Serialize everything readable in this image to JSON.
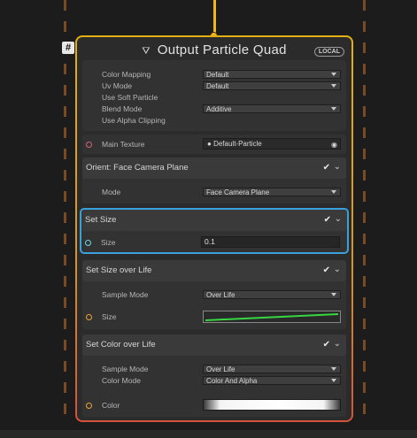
{
  "header": {
    "title": "Output Particle Quad",
    "badge": "LOCAL",
    "hash_label": "#"
  },
  "output_settings": {
    "rows": [
      {
        "label": "Color Mapping",
        "value": "Default"
      },
      {
        "label": "Uv Mode",
        "value": "Default"
      },
      {
        "label": "Use Soft Particle",
        "value": ""
      },
      {
        "label": "Blend Mode",
        "value": "Additive"
      },
      {
        "label": "Use Alpha Clipping",
        "value": ""
      }
    ],
    "main_texture": {
      "label": "Main Texture",
      "value": "Default-Particle"
    }
  },
  "blocks": {
    "orient": {
      "title": "Orient: Face Camera Plane",
      "mode_label": "Mode",
      "mode_value": "Face Camera Plane"
    },
    "set_size": {
      "title": "Set Size",
      "size_label": "Size",
      "size_value": "0.1"
    },
    "size_over_life": {
      "title": "Set Size over Life",
      "sample_label": "Sample Mode",
      "sample_value": "Over Life",
      "size_label": "Size"
    },
    "color_over_life": {
      "title": "Set Color over Life",
      "sample_label": "Sample Mode",
      "sample_value": "Over Life",
      "color_mode_label": "Color Mode",
      "color_mode_value": "Color And Alpha",
      "color_label": "Color"
    }
  },
  "icons": {
    "checkbox": "✔",
    "chevron": "⌄"
  },
  "colors": {
    "accent_selected": "#3aa0dc",
    "port_texture": "#d9617a",
    "port_size": "#6bd8e8",
    "port_orange": "#e9a431",
    "curve": "#37d642"
  }
}
